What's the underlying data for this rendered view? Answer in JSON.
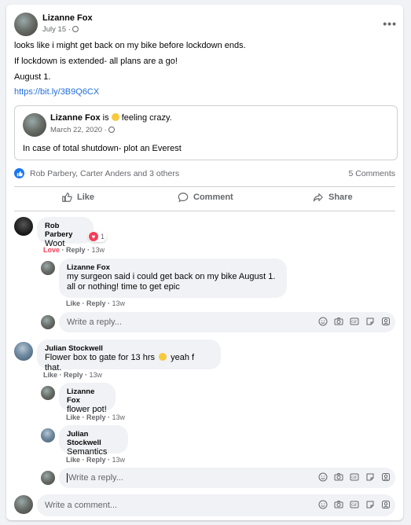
{
  "post": {
    "author": "Lizanne Fox",
    "date": "July 15",
    "lines": [
      "looks like i might get back on my bike before lockdown ends.",
      "If lockdown is extended- all plans are a go!",
      "August 1."
    ],
    "link": "https://bit.ly/3B9Q6CX",
    "more_label": "•••"
  },
  "shared": {
    "author": "Lizanne Fox",
    "is_word": "is",
    "feeling": "feeling crazy.",
    "date": "March 22, 2020",
    "text": "In case of total shutdown- plot an Everest"
  },
  "stats": {
    "reactors": "Rob Parbery, Carter Anders and 3 others",
    "comments": "5 Comments"
  },
  "actions": {
    "like": "Like",
    "comment": "Comment",
    "share": "Share"
  },
  "comments": [
    {
      "author": "Rob Parbery",
      "text": "Woot",
      "react_count": "1",
      "love": "Love",
      "reply": "Reply",
      "time": "13w"
    },
    {
      "author": "Lizanne Fox",
      "text1": "my surgeon said i could get back on my bike August 1.",
      "text2": "all or nothing! time to get epic",
      "like": "Like",
      "reply": "Reply",
      "time": "13w"
    },
    {
      "author": "Julian Stockwell",
      "text": "Flower box to gate for 13 hrs",
      "text_after": "yeah f that.",
      "like": "Like",
      "reply": "Reply",
      "time": "13w"
    },
    {
      "author": "Lizanne Fox",
      "text": "flower pot!",
      "like": "Like",
      "reply": "Reply",
      "time": "13w"
    },
    {
      "author": "Julian Stockwell",
      "text": "Semantics",
      "like": "Like",
      "reply": "Reply",
      "time": "13w"
    }
  ],
  "reply_placeholder": "Write a reply...",
  "comment_placeholder": "Write a comment...",
  "colors": {
    "link": "#216fdb",
    "love": "#f33e58",
    "like_blue": "#1877f2"
  }
}
